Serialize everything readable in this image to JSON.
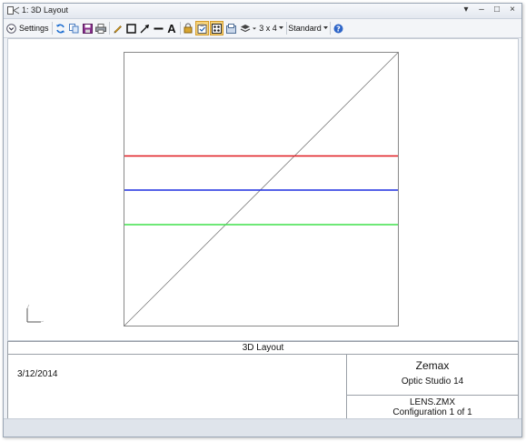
{
  "window": {
    "title": "1: 3D Layout"
  },
  "window_controls": {
    "menu": "▾",
    "minimize": "–",
    "maximize": "□",
    "close": "×"
  },
  "toolbar": {
    "settings_label": "Settings",
    "text_tool_glyph": "A",
    "layout_label": "3 x 4",
    "style_label": "Standard"
  },
  "plot": {
    "rays": [
      {
        "color": "#e0181e"
      },
      {
        "color": "#1f2fe0"
      },
      {
        "color": "#3ee04a"
      }
    ],
    "axis_color": "#7a7a7a",
    "frame_color": "#888888"
  },
  "info": {
    "plot_title": "3D Layout",
    "date": "3/12/2014",
    "company": "Zemax",
    "product": "Optic Studio 14",
    "file": "LENS.ZMX",
    "configuration": "Configuration 1 of 1"
  }
}
